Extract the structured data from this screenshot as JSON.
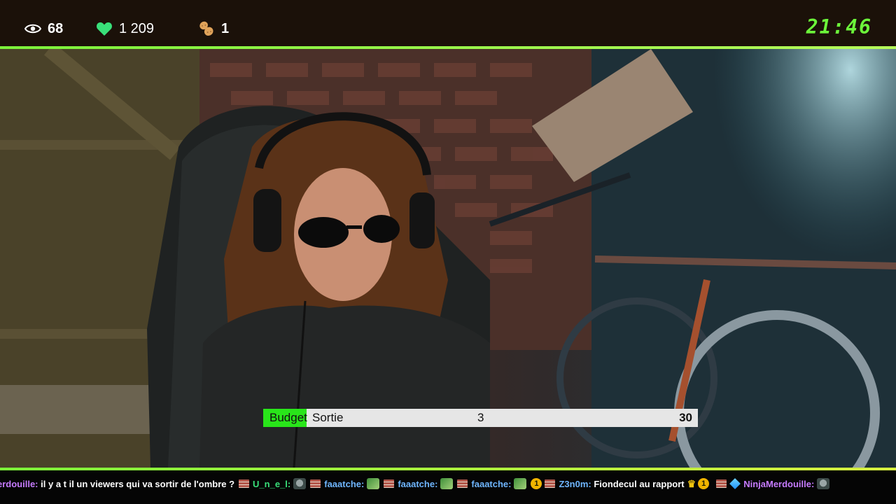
{
  "stats": {
    "views": {
      "icon": "eye-icon",
      "value": "68"
    },
    "likes": {
      "icon": "heart-icon",
      "value": "1 209",
      "color": "#39e07a"
    },
    "peanuts": {
      "icon": "peanut-icon",
      "value": "1"
    }
  },
  "clock": {
    "time": "21:46",
    "color": "#6cf53a"
  },
  "accent_color": "#7cf23a",
  "budget": {
    "label": "Budget",
    "name": "Sortie",
    "current": "3",
    "max": "30",
    "progress": 0.1,
    "fill_color": "#29e51a"
  },
  "ticker": {
    "messages": [
      {
        "user": "erdouille:",
        "user_color": "#c67bff",
        "text": "il y a t il un viewers qui va sortir de l'ombre ?"
      },
      {
        "user": "U_n_e_l:",
        "user_color": "#39e07a",
        "text": ""
      },
      {
        "user": "faaatche:",
        "user_color": "#6fb6ff",
        "text": ""
      },
      {
        "user": "faaatche:",
        "user_color": "#6fb6ff",
        "text": ""
      },
      {
        "user": "faaatche:",
        "user_color": "#6fb6ff",
        "text": ""
      },
      {
        "user": "Z3n0m:",
        "user_color": "#6fb6ff",
        "text": "Fiondecul au rapport"
      },
      {
        "user": "NinjaMerdouille:",
        "user_color": "#c67bff",
        "text": ""
      }
    ]
  }
}
